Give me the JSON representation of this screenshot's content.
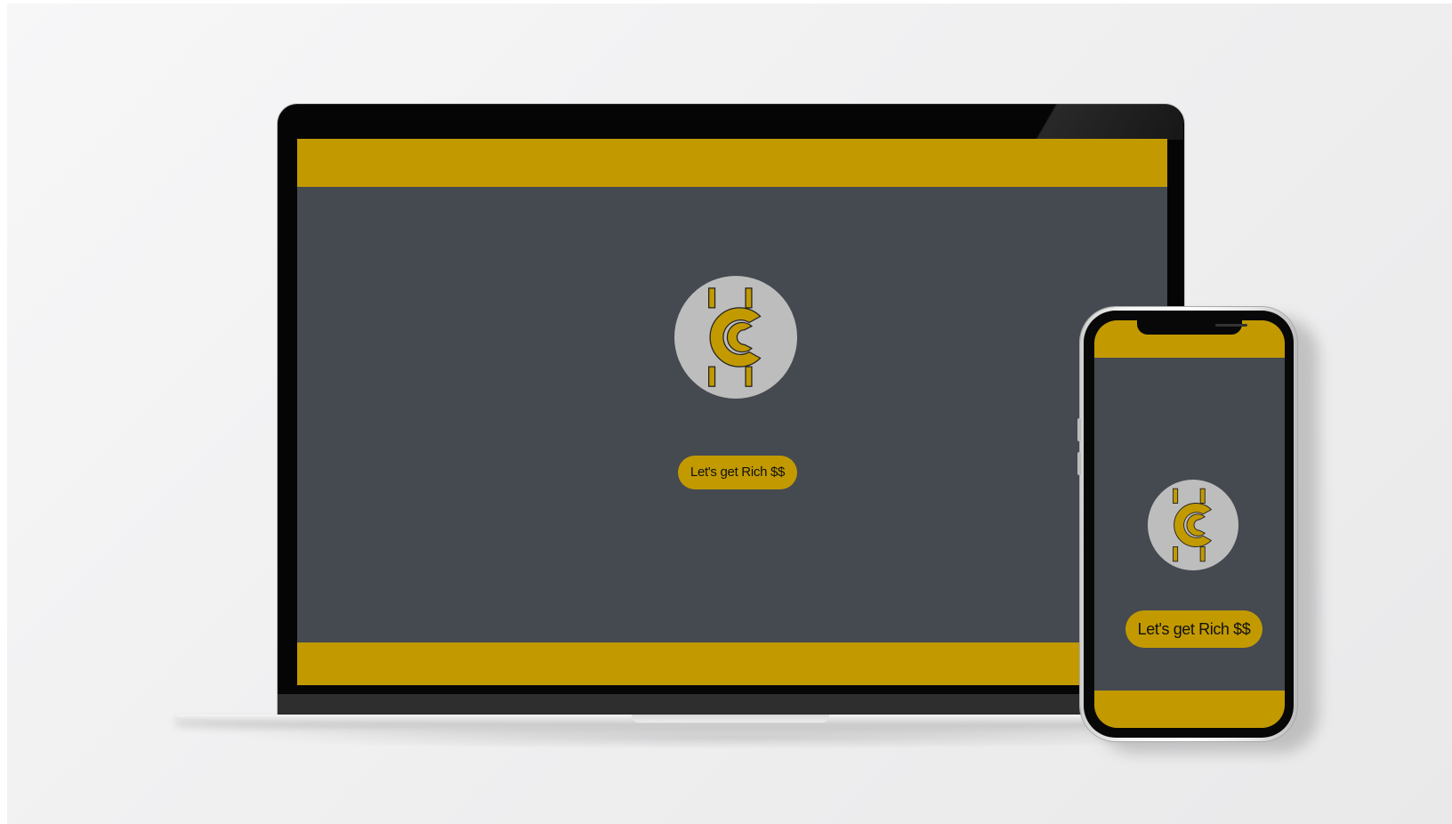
{
  "colors": {
    "accent": "#c29a00",
    "screen_background": "#454950",
    "logo_circle": "#bdbdbd"
  },
  "laptop": {
    "logo_icon": "crypto-coin-c-icon",
    "button_label": "Let's get Rich $$"
  },
  "phone": {
    "logo_icon": "crypto-coin-c-icon",
    "button_label": "Let's get Rich $$"
  }
}
